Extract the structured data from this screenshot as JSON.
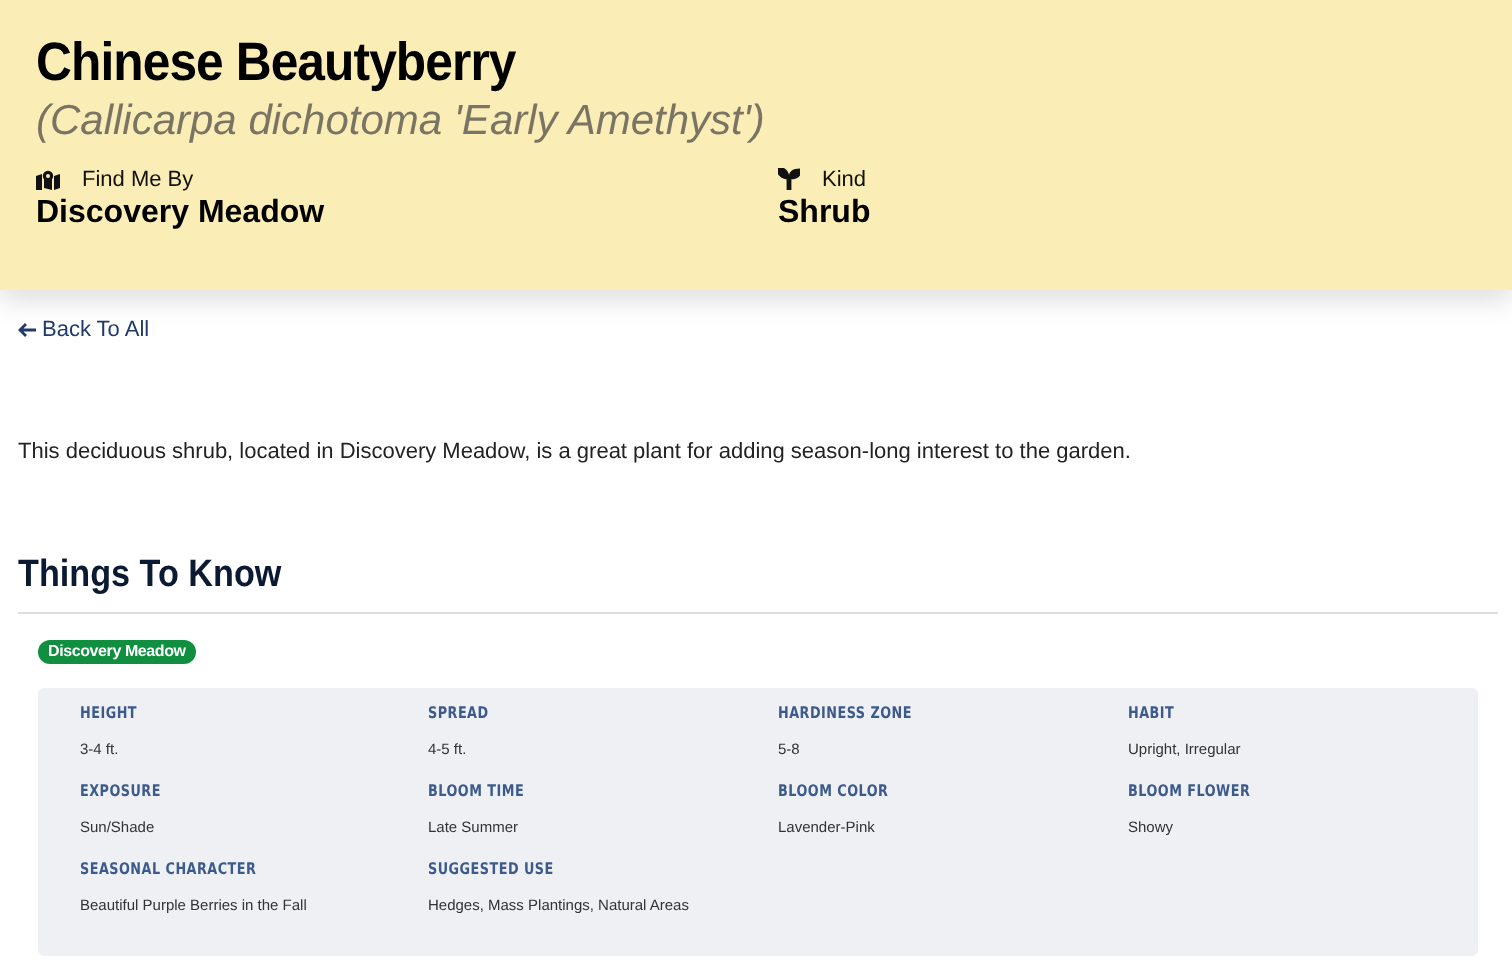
{
  "header": {
    "title": "Chinese Beautyberry",
    "scientific_name": "(Callicarpa dichotoma 'Early Amethyst')",
    "meta": [
      {
        "label": "Find Me By",
        "value": "Discovery Meadow",
        "kind": "map"
      },
      {
        "label": "Kind",
        "value": "Shrub",
        "kind": "sprout"
      }
    ]
  },
  "back_link": "Back To All",
  "description": "This deciduous shrub, located in Discovery Meadow, is a great plant for adding season-long interest to the garden.",
  "section_title": "Things To Know",
  "location_badge": {
    "label": "Discovery Meadow",
    "color": "#0f8f3f"
  },
  "facts": [
    {
      "label": "HEIGHT",
      "value": "3-4 ft."
    },
    {
      "label": "SPREAD",
      "value": "4-5 ft."
    },
    {
      "label": "HARDINESS ZONE",
      "value": "5-8"
    },
    {
      "label": "HABIT",
      "value": "Upright, Irregular"
    },
    {
      "label": "EXPOSURE",
      "value": "Sun/Shade"
    },
    {
      "label": "BLOOM TIME",
      "value": "Late Summer"
    },
    {
      "label": "BLOOM COLOR",
      "value": "Lavender-Pink"
    },
    {
      "label": "BLOOM FLOWER",
      "value": "Showy"
    },
    {
      "label": "SEASONAL CHARACTER",
      "value": "Beautiful Purple Berries in the Fall"
    },
    {
      "label": "SUGGESTED USE",
      "value": "Hedges, Mass Plantings, Natural Areas"
    }
  ]
}
